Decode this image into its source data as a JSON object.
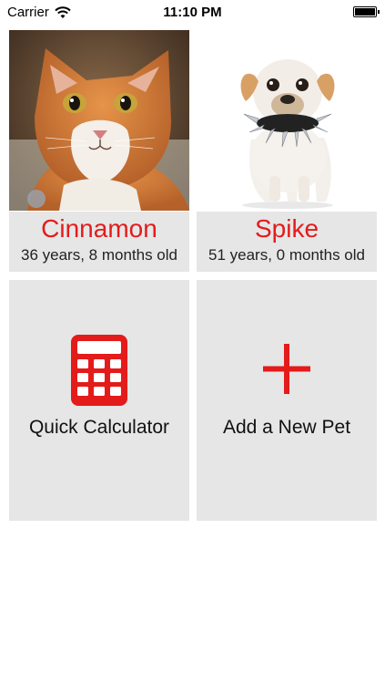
{
  "status_bar": {
    "carrier": "Carrier",
    "time": "11:10 PM",
    "battery_level": 1.0
  },
  "pets": [
    {
      "name": "Cinnamon",
      "age": "36 years, 8 months old",
      "photo": "orange-tabby-cat"
    },
    {
      "name": "Spike",
      "age": "51 years, 0 months old",
      "photo": "small-dog-spiked-collar"
    }
  ],
  "actions": {
    "calculator_label": "Quick Calculator",
    "add_pet_label": "Add a New Pet"
  },
  "colors": {
    "accent": "#e41b1b",
    "tile_bg": "#e6e6e6"
  }
}
